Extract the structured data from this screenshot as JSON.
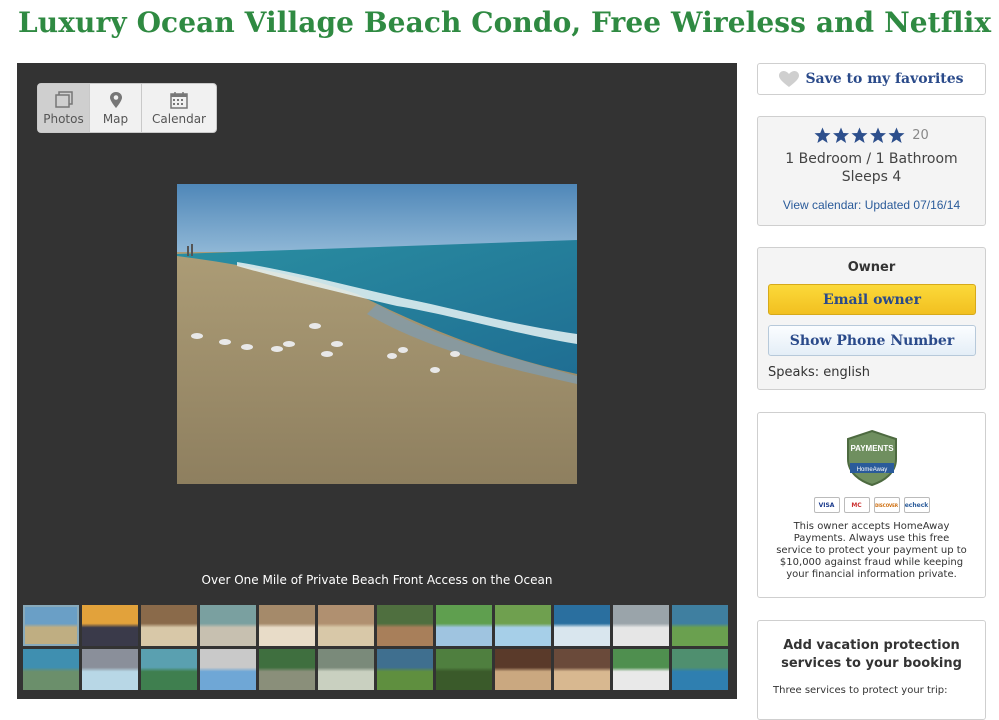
{
  "title": "Luxury Ocean Village Beach Condo, Free Wireless and Netflix",
  "gallery": {
    "tabs": [
      {
        "label": "Photos",
        "icon": "photos-icon"
      },
      {
        "label": "Map",
        "icon": "map-pin-icon"
      },
      {
        "label": "Calendar",
        "icon": "calendar-icon"
      }
    ],
    "caption": "Over One Mile of Private Beach Front Access on the Ocean"
  },
  "sidebar": {
    "favorites_label": "Save to my favorites",
    "rating_count": "20",
    "bed_bath": "1 Bedroom / 1 Bathroom",
    "sleeps": "Sleeps 4",
    "calendar_link": "View calendar: Updated 07/16/14",
    "owner_header": "Owner",
    "email_button": "Email owner",
    "phone_button": "Show Phone Number",
    "speaks": "Speaks: english",
    "payments_badge_title": "PAYMENTS",
    "payments_badge_sub": "HomeAway",
    "card_labels": [
      "VISA",
      "MC",
      "DISCOVER",
      "echeck"
    ],
    "payments_text": "This owner accepts HomeAway Payments. Always use this free service to protect your payment up to $10,000 against fraud while keeping your financial information private.",
    "protection_header": "Add vacation protection services to your booking",
    "protection_sub": "Three services to protect your trip:"
  },
  "colors": {
    "title": "#2f8a42",
    "link": "#2a4a8a",
    "star": "#2d4f8c",
    "gallery_bg": "#333333"
  }
}
